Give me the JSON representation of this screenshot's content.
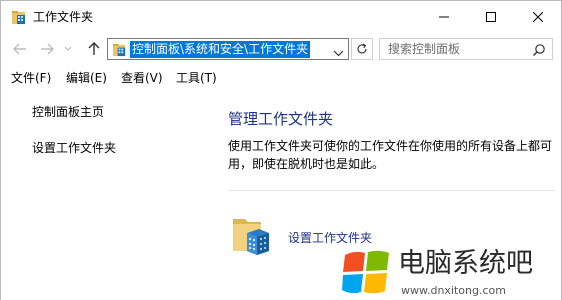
{
  "window": {
    "title": "工作文件夹"
  },
  "address": {
    "path": "控制面板\\系统和安全\\工作文件夹"
  },
  "search": {
    "placeholder": "搜索控制面板"
  },
  "menu": {
    "file": "文件(F)",
    "edit": "编辑(E)",
    "view": "查看(V)",
    "tools": "工具(T)"
  },
  "sidebar": {
    "items": [
      {
        "label": "控制面板主页"
      },
      {
        "label": "设置工作文件夹"
      }
    ]
  },
  "main": {
    "heading": "管理工作文件夹",
    "description": "使用工作文件夹可使你的工作文件在你使用的所有设备上都可用，即使在脱机时也是如此。",
    "action_label": "设置工作文件夹"
  },
  "watermark": {
    "title": "电脑系统吧",
    "url": "www.dnxitong.com"
  },
  "colors": {
    "selection": "#0078d7",
    "link": "#1e3287"
  },
  "icons": {
    "app": "work-folders-icon",
    "back": "back-arrow-icon",
    "forward": "forward-arrow-icon",
    "recent": "recent-locations-chevron-icon",
    "up": "up-arrow-icon",
    "refresh": "refresh-icon",
    "search": "search-icon",
    "action": "work-folders-large-icon"
  }
}
